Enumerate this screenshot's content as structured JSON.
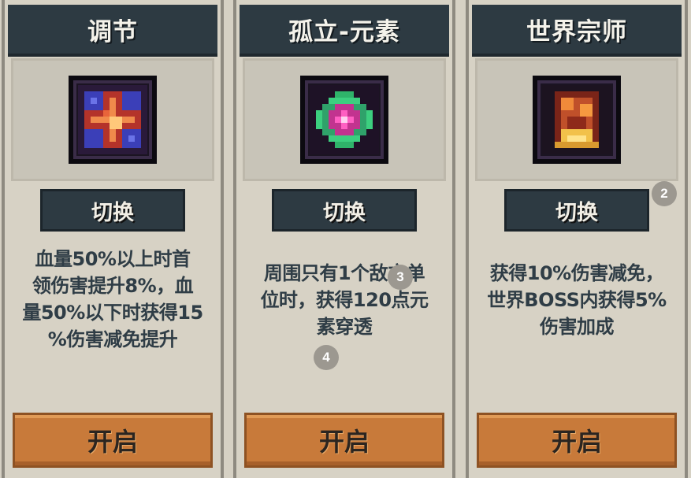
{
  "cards": [
    {
      "title": "调节",
      "switch_label": "切换",
      "description_lines": [
        "血量50%以上时首",
        "领伤害提升8%，血",
        "量50%以下时获得15",
        "%伤害减免提升"
      ],
      "open_label": "开启",
      "icon": "cross-rune-icon"
    },
    {
      "title": "孤立-元素",
      "switch_label": "切换",
      "description_lines": [
        "周围只有1个敌方单",
        "位时，获得120点元",
        "素穿透"
      ],
      "open_label": "开启",
      "icon": "element-gem-icon"
    },
    {
      "title": "世界宗师",
      "switch_label": "切换",
      "description_lines": [
        "获得10%伤害减免，",
        "世界BOSS内获得5%",
        "伤害加成"
      ],
      "open_label": "开启",
      "icon": "fire-scroll-icon"
    }
  ],
  "badges": [
    "2",
    "3",
    "4"
  ]
}
